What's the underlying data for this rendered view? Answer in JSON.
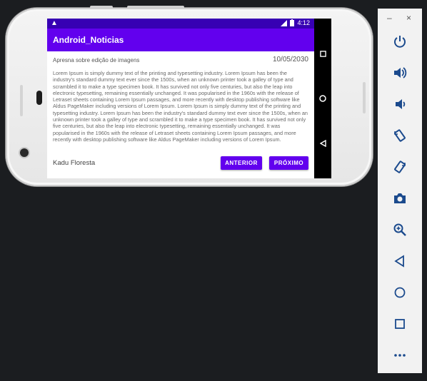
{
  "status_bar": {
    "warning_icon": "warning-icon",
    "time": "4:12"
  },
  "app": {
    "title": "Android_Noticias"
  },
  "article": {
    "subtitle": "Apresna sobre edição de imagens",
    "date": "10/05/2030",
    "body": "Lorem Ipsum is simply dummy text of the printing and typesetting industry. Lorem Ipsum has been the industry's standard dummy text ever since the 1500s, when an unknown printer took a galley of type and scrambled it to make a type specimen book. It has survived not only five centuries, but also the leap into electronic typesetting, remaining essentially unchanged. It was popularised in the 1960s with the release of Letraset sheets containing Lorem Ipsum passages, and more recently with desktop publishing software like Aldus PageMaker including versions of Lorem Ipsum. Lorem Ipsum is simply dummy text of the printing and typesetting industry. Lorem Ipsum has been the industry's standard dummy text ever since the 1500s, when an unknown printer took a galley of type and scrambled it to make a type specimen book. It has survived not only five centuries, but also the leap into electronic typesetting, remaining essentially unchanged. It was popularised in the 1960s with the release of Letraset sheets containing Lorem Ipsum passages, and more recently with desktop publishing software like Aldus PageMaker including versions of Lorem Ipsum.",
    "author": "Kadu Floresta",
    "prev_label": "ANTERIOR",
    "next_label": "PRÓXIMO"
  },
  "nav": {
    "icons": [
      "square-icon",
      "circle-icon",
      "back-triangle-icon"
    ]
  },
  "emulator_toolbar": {
    "minimize": "–",
    "close": "×",
    "icons": [
      "power-icon",
      "volume-up-icon",
      "volume-down-icon",
      "rotate-left-icon",
      "rotate-right-icon",
      "camera-icon",
      "zoom-icon",
      "back-icon",
      "home-icon",
      "overview-icon",
      "more-icon"
    ]
  },
  "colors": {
    "primary": "#6200ee",
    "primary_dark": "#3700b3",
    "toolbar_icon": "#1b4a8d"
  }
}
